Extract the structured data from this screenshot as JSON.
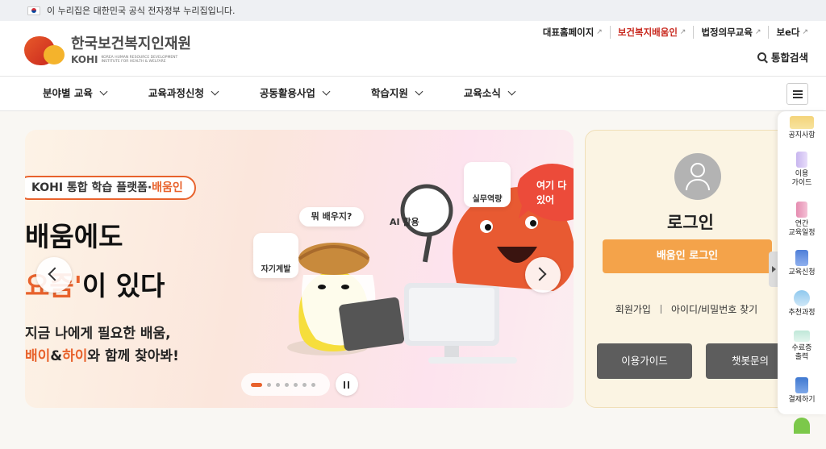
{
  "gov_bar": {
    "text": "이 누리집은 대한민국 공식 전자정부 누리집입니다."
  },
  "logo": {
    "kr": "한국보건복지인재원",
    "en_short": "KOHI",
    "en_full": "KOREA HUMAN RESOURCE DEVELOPMENT INSTITUTE FOR HEALTH & WELFARE"
  },
  "util_links": [
    "대표홈페이지",
    "보건복지배움인",
    "법정의무교육",
    "보e다"
  ],
  "search": {
    "label": "통합검색"
  },
  "nav": [
    "분야별 교육",
    "교육과정신청",
    "공동활용사업",
    "학습지원",
    "교육소식"
  ],
  "banner": {
    "pill_prefix": "KOHI 통합 학습 플랫폼·",
    "pill_highlight": "배움인",
    "headline1": "배움에도",
    "headline2_a": "요즘'",
    "headline2_b": "이 있다",
    "sub1": "지금 나에게 필요한 배움,",
    "sub2_a": "배이",
    "sub2_b": "&",
    "sub2_c": "하이",
    "sub2_d": "와 함께 찾아봐!",
    "tag_self": "자기계발",
    "tag_what": "뭐 배우지?",
    "tag_ai": "AI 활용",
    "tag_skill": "실무역량",
    "tag_here": "여기 다 있어",
    "slide_count": 7,
    "active_slide": 1
  },
  "login": {
    "title": "로그인",
    "primary_button": "배움인 로그인",
    "link_signup": "회원가입",
    "link_find": "아이디/비밀번호 찾기",
    "guide_button": "이용가이드",
    "chatbot_button": "챗봇문의"
  },
  "quick_menu": [
    "공지사항",
    "이용\n가이드",
    "연간\n교육일정",
    "교육신청",
    "추천과정",
    "수료증\n출력",
    "결제하기"
  ],
  "colors": {
    "accent": "#e8622c",
    "login_button": "#f4a34a",
    "util_highlight": "#c8281e"
  }
}
